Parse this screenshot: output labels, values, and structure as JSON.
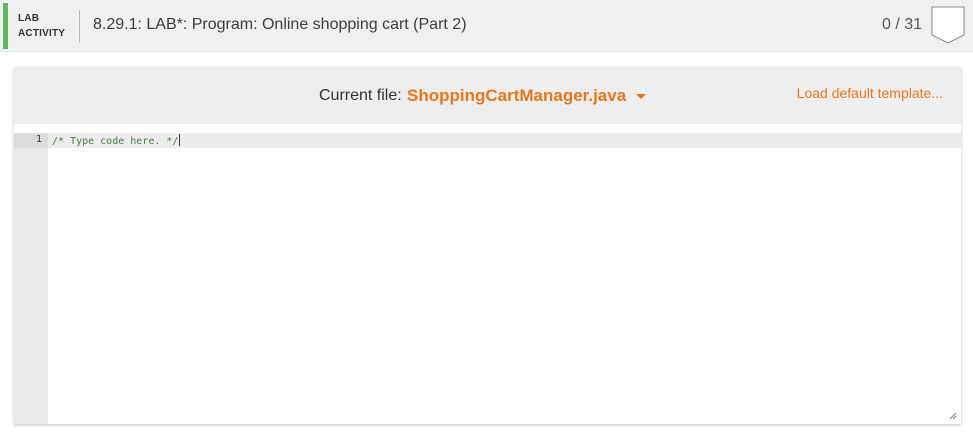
{
  "header": {
    "tag_line1": "LAB",
    "tag_line2": "ACTIVITY",
    "title": "8.29.1: LAB*: Program: Online shopping cart (Part 2)",
    "score": "0 / 31",
    "accent_color": "#5cb85c",
    "badge_icon": "score-badge-icon"
  },
  "toolbar": {
    "current_file_label": "Current file:",
    "current_file_name": "ShoppingCartManager.java",
    "file_dropdown_icon": "caret-down-icon",
    "load_template_link": "Load default template...",
    "link_color": "#e8761c"
  },
  "editor": {
    "lines": [
      {
        "number": "1",
        "text": "/* Type code here. */"
      }
    ]
  }
}
